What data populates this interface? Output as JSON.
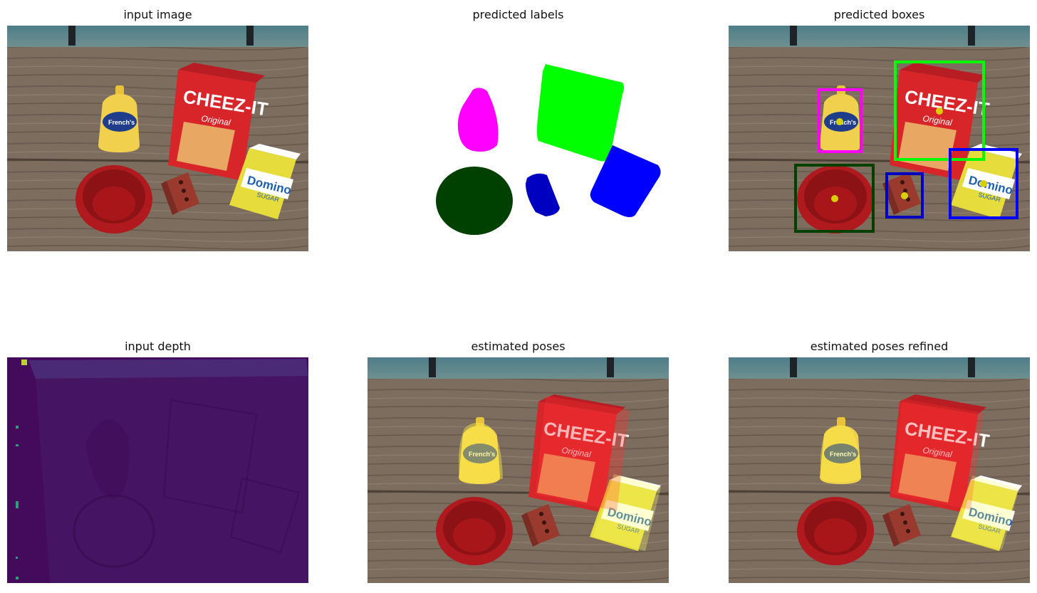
{
  "titles": {
    "input_image": "input image",
    "predicted_labels": "predicted labels",
    "predicted_boxes": "predicted boxes",
    "input_depth": "input depth",
    "estimated_poses": "estimated poses",
    "estimated_poses_refined": "estimated poses refined"
  },
  "product_text": {
    "cheezit": "CHEEZ-IT",
    "cheezit_sub": "Original",
    "domino": "Domino",
    "domino_sub": "SUGAR",
    "mustard": "French's"
  },
  "colors": {
    "label_mustard": "#ff00ff",
    "label_cheezit": "#00ff00",
    "label_bowl": "#004000",
    "label_brick": "#0000c0",
    "label_sugar": "#0000ff",
    "box_center_dot": "#d6d000",
    "depth_background": "#440a5c",
    "depth_floor": "#4a1a6e",
    "table_wood": "#7a6a5a",
    "wall_blue": "#5a8a94"
  }
}
